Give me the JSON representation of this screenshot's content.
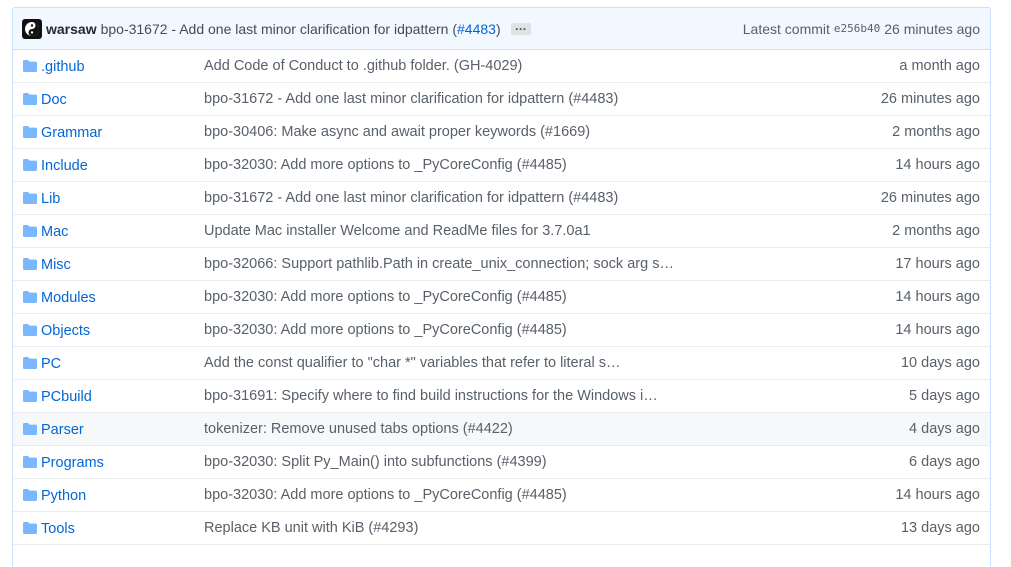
{
  "commit": {
    "author": "warsaw",
    "message": "bpo-31672 - Add one last minor clarification for idpattern (",
    "pr_link": "#4483",
    "message_end": ")",
    "ellipsis": "…",
    "latest_label": "Latest commit",
    "sha": "e256b40",
    "age": "26 minutes ago"
  },
  "files": [
    {
      "name": ".github",
      "message": "Add Code of Conduct to .github folder. (GH-4029)",
      "age": "a month ago"
    },
    {
      "name": "Doc",
      "message": "bpo-31672 - Add one last minor clarification for idpattern (#4483)",
      "age": "26 minutes ago"
    },
    {
      "name": "Grammar",
      "message": "bpo-30406: Make async and await proper keywords (#1669)",
      "age": "2 months ago"
    },
    {
      "name": "Include",
      "message": "bpo-32030: Add more options to _PyCoreConfig (#4485)",
      "age": "14 hours ago"
    },
    {
      "name": "Lib",
      "message": "bpo-31672 - Add one last minor clarification for idpattern (#4483)",
      "age": "26 minutes ago"
    },
    {
      "name": "Mac",
      "message": "Update Mac installer Welcome and ReadMe files for 3.7.0a1",
      "age": "2 months ago"
    },
    {
      "name": "Misc",
      "message": "bpo-32066: Support pathlib.Path in create_unix_connection; sock arg s…",
      "age": "17 hours ago"
    },
    {
      "name": "Modules",
      "message": "bpo-32030: Add more options to _PyCoreConfig (#4485)",
      "age": "14 hours ago"
    },
    {
      "name": "Objects",
      "message": "bpo-32030: Add more options to _PyCoreConfig (#4485)",
      "age": "14 hours ago"
    },
    {
      "name": "PC",
      "message": "Add the const qualifier to \"char *\" variables that refer to literal s…",
      "age": "10 days ago"
    },
    {
      "name": "PCbuild",
      "message": "bpo-31691: Specify where to find build instructions for the Windows i…",
      "age": "5 days ago"
    },
    {
      "name": "Parser",
      "message": "tokenizer: Remove unused tabs options (#4422)",
      "age": "4 days ago"
    },
    {
      "name": "Programs",
      "message": "bpo-32030: Split Py_Main() into subfunctions (#4399)",
      "age": "6 days ago"
    },
    {
      "name": "Python",
      "message": "bpo-32030: Add more options to _PyCoreConfig (#4485)",
      "age": "14 hours ago"
    },
    {
      "name": "Tools",
      "message": "Replace KB unit with KiB (#4293)",
      "age": "13 days ago"
    }
  ],
  "highlighted_row": "Parser",
  "colors": {
    "link": "#0366d6",
    "folder": "#79b8ff",
    "header_bg": "#f1f8ff",
    "row_highlight": "#f6f8fa"
  }
}
